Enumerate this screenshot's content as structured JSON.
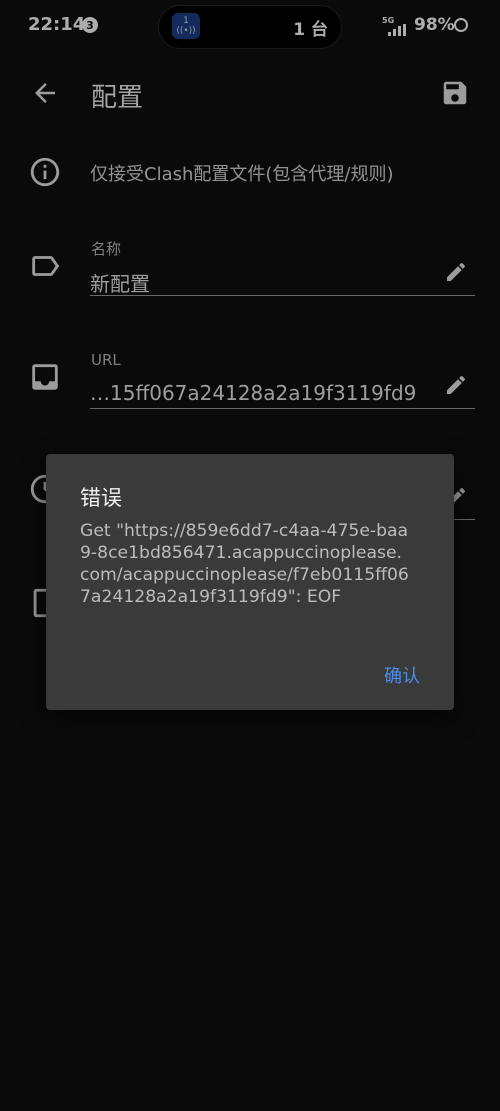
{
  "status_bar": {
    "time": "22:14",
    "notification_count": "3",
    "island_icon_count": "1",
    "island_text": "1 台",
    "network": "5G",
    "battery": "98%"
  },
  "app_bar": {
    "title": "配置"
  },
  "hint": {
    "text": "仅接受Clash配置文件(包含代理/规则)"
  },
  "fields": {
    "name": {
      "label": "名称",
      "value": "新配置"
    },
    "url": {
      "label": "URL",
      "value": "…15ff067a24128a2a19f3119fd9"
    }
  },
  "dialog": {
    "title": "错误",
    "message": "Get \"https://859e6dd7-c4aa-475e-baa9-8ce1bd856471.acappuccinoplease.com/acappuccinoplease/f7eb0115ff067a24128a2a19f3119fd9\": EOF",
    "confirm_label": "确认"
  },
  "colors": {
    "background": "#0f0f0f",
    "dialog_background": "#3a3a3a",
    "accent": "#4d8eea"
  },
  "icons": {
    "back": "arrow-back-icon",
    "save": "save-icon",
    "info": "info-icon",
    "name": "label-icon",
    "url": "inbox-icon",
    "edit": "pencil-icon"
  }
}
